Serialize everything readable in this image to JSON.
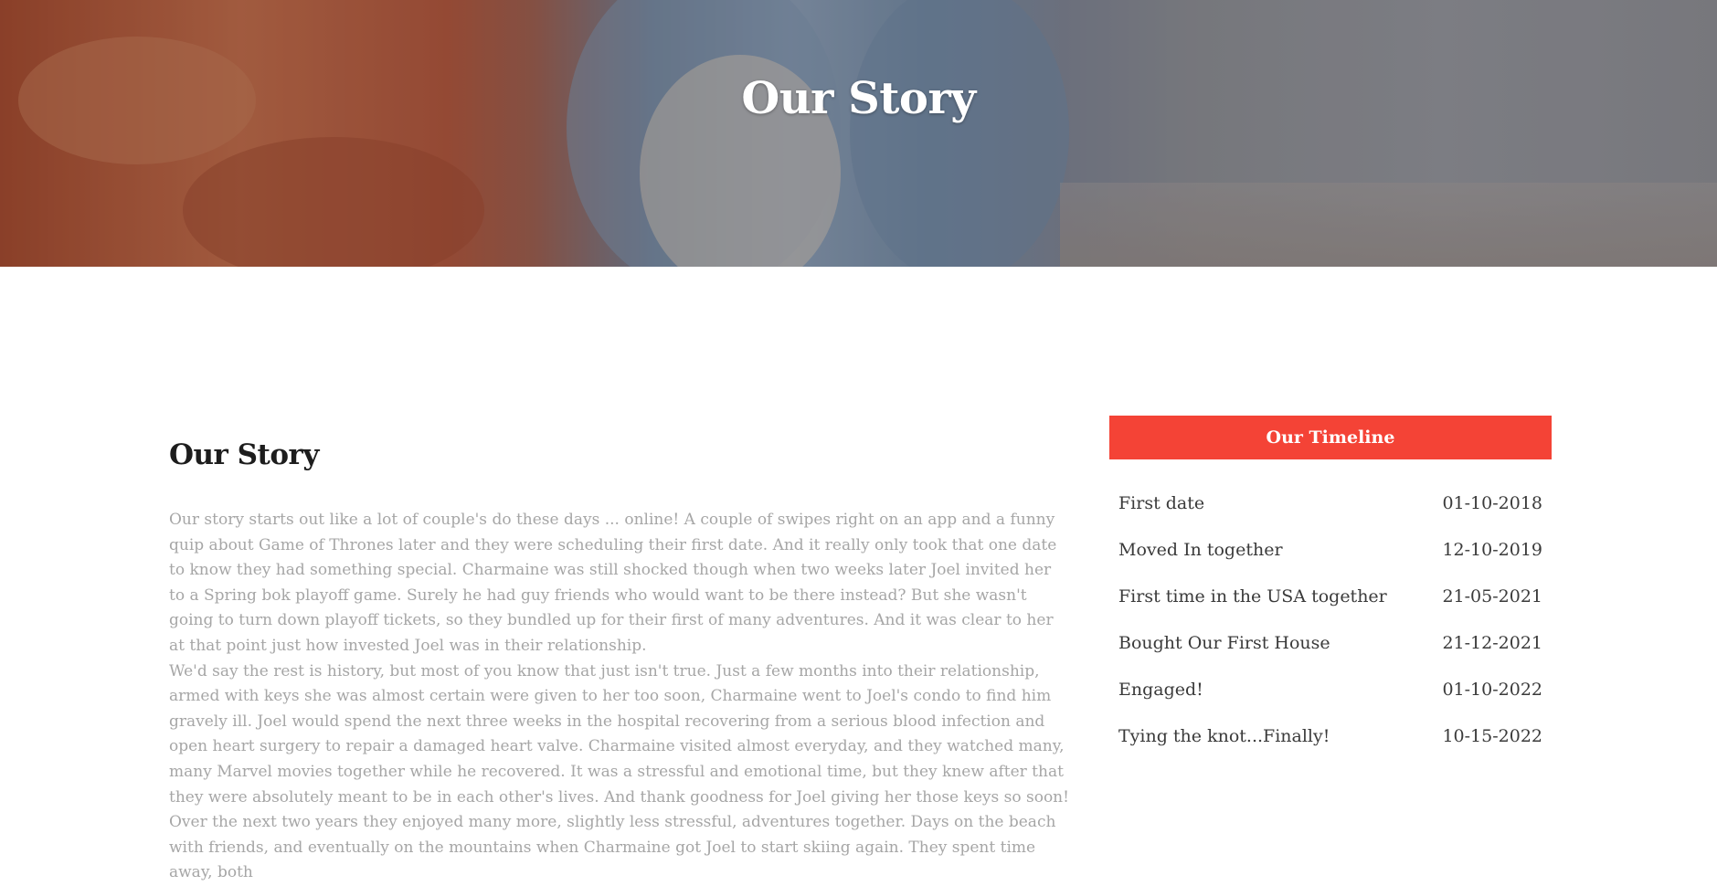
{
  "hero": {
    "title": "Our Story"
  },
  "story": {
    "heading": "Our Story",
    "paragraphs": [
      "Our story starts out like a lot of couple's do these days ... online! A couple of swipes right on an app and a funny quip about Game of Thrones later and they were scheduling their first date. And it really only took that one date to know they had something special. Charmaine was still shocked though when two weeks later Joel invited her to a Spring bok playoff game. Surely he had guy friends who would want to be there instead? But she wasn't going to turn down playoff tickets, so they bundled up for their first of many adventures. And it was clear to her at that point just how invested Joel was in their relationship.",
      "We'd say the rest is history, but most of you know that just isn't true. Just a few months into their relationship, armed with keys she was almost certain were given to her too soon, Charmaine went to Joel's condo to find him gravely ill. Joel would spend the next three weeks in the hospital recovering from a serious blood infection and open heart surgery to repair a damaged heart valve. Charmaine visited almost everyday, and they watched many, many Marvel movies together while he recovered. It was a stressful and emotional time, but they knew after that they were absolutely meant to be in each other's lives. And thank goodness for Joel giving her those keys so soon!",
      "Over the next two years they enjoyed many more, slightly less stressful, adventures together. Days on the beach with friends, and eventually on the mountains when Charmaine got Joel to start skiing again. They spent time away, both"
    ]
  },
  "timeline": {
    "title": "Our Timeline",
    "events": [
      {
        "label": "First date",
        "date": "01-10-2018"
      },
      {
        "label": "Moved In together",
        "date": "12-10-2019"
      },
      {
        "label": "First time in the USA together",
        "date": "21-05-2021"
      },
      {
        "label": "Bought Our First House",
        "date": "21-12-2021"
      },
      {
        "label": "Engaged!",
        "date": "01-10-2022"
      },
      {
        "label": "Tying the knot...Finally!",
        "date": "10-15-2022"
      }
    ]
  }
}
